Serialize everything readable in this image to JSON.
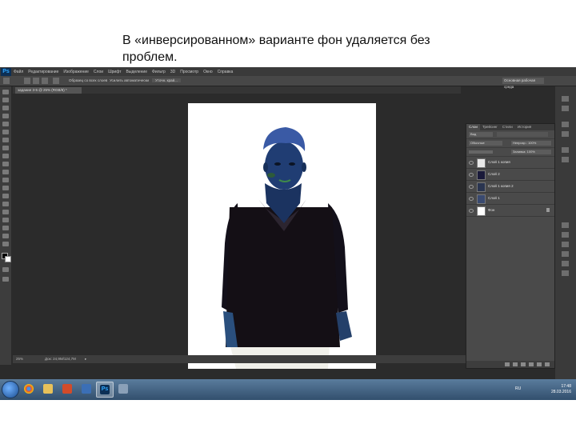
{
  "caption": {
    "line1": "В «инверсированном» варианте фон удаляется  без",
    "line2": "проблем."
  },
  "app": {
    "logo": "Ps",
    "menu": [
      "Файл",
      "Редактирование",
      "Изображение",
      "Слои",
      "Шрифт",
      "Выделение",
      "Фильтр",
      "3D",
      "Просмотр",
      "Окно",
      "Справка"
    ]
  },
  "options_bar": {
    "sample_all": "Образец со всех слоев",
    "auto_enhance": "Усилить автоматически",
    "refine_edge": "Уточн. край...",
    "workspace": "Основная рабочая среда"
  },
  "document": {
    "tab_title": "задание 3-5 @ 25% (RGB/8) *"
  },
  "status": {
    "zoom": "25%",
    "doc_info": "Док: 24,9M/124,7M"
  },
  "layers_panel": {
    "tabs": [
      "Слои",
      "Трейсинг",
      "Стили",
      "История"
    ],
    "filter_kind": "Вид",
    "blend_mode": "Обычные",
    "opacity": "Непрозр.: 100%",
    "fill": "Заливка: 100%",
    "layers": [
      {
        "name": "Слой 1 копия",
        "thumb": "#e8e8e8"
      },
      {
        "name": "Слой 2",
        "thumb": "#1a1a3a"
      },
      {
        "name": "Слой 1 копия 2",
        "thumb": "#2a3550"
      },
      {
        "name": "Слой 1",
        "thumb": "#3a4a70"
      },
      {
        "name": "Фон",
        "thumb": "#ffffff"
      }
    ]
  },
  "taskbar": {
    "ps_icon": "Ps",
    "lang": "RU",
    "time": "17:48",
    "date": "28.03.2016"
  },
  "colors": {
    "panel_bg": "#2b2b2b",
    "canvas_bg": "#ffffff",
    "accent": "#31a8ff"
  }
}
